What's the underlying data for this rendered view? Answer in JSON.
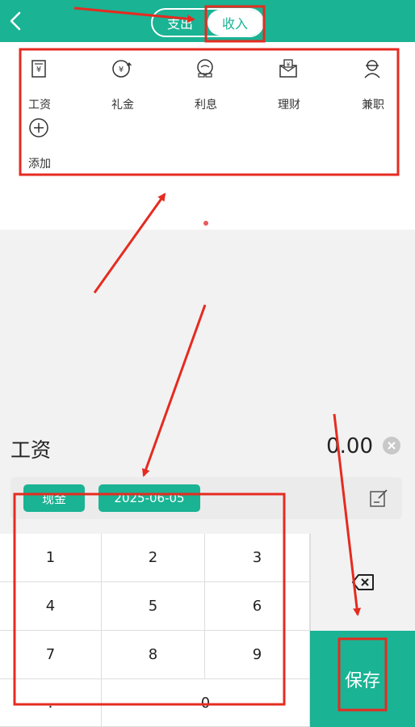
{
  "header": {
    "back_icon": "chevron-left-icon",
    "tabs": [
      {
        "label": "支出"
      },
      {
        "label": "收入"
      }
    ]
  },
  "categories": [
    {
      "label": "工资",
      "icon": "wage-icon"
    },
    {
      "label": "礼金",
      "icon": "gift-money-icon"
    },
    {
      "label": "利息",
      "icon": "interest-icon"
    },
    {
      "label": "理财",
      "icon": "finance-icon"
    },
    {
      "label": "兼职",
      "icon": "part-time-icon"
    },
    {
      "label": "添加",
      "icon": "add-icon"
    }
  ],
  "entry": {
    "category": "工资",
    "amount": "0.00",
    "account": "现金",
    "date": "2025-06-05"
  },
  "keypad": {
    "keys": [
      "1",
      "2",
      "3",
      "4",
      "5",
      "6",
      "7",
      "8",
      "9",
      ".",
      "0"
    ],
    "save_label": "保存"
  },
  "colors": {
    "accent": "#1ab394",
    "annotation": "#e52b20"
  }
}
